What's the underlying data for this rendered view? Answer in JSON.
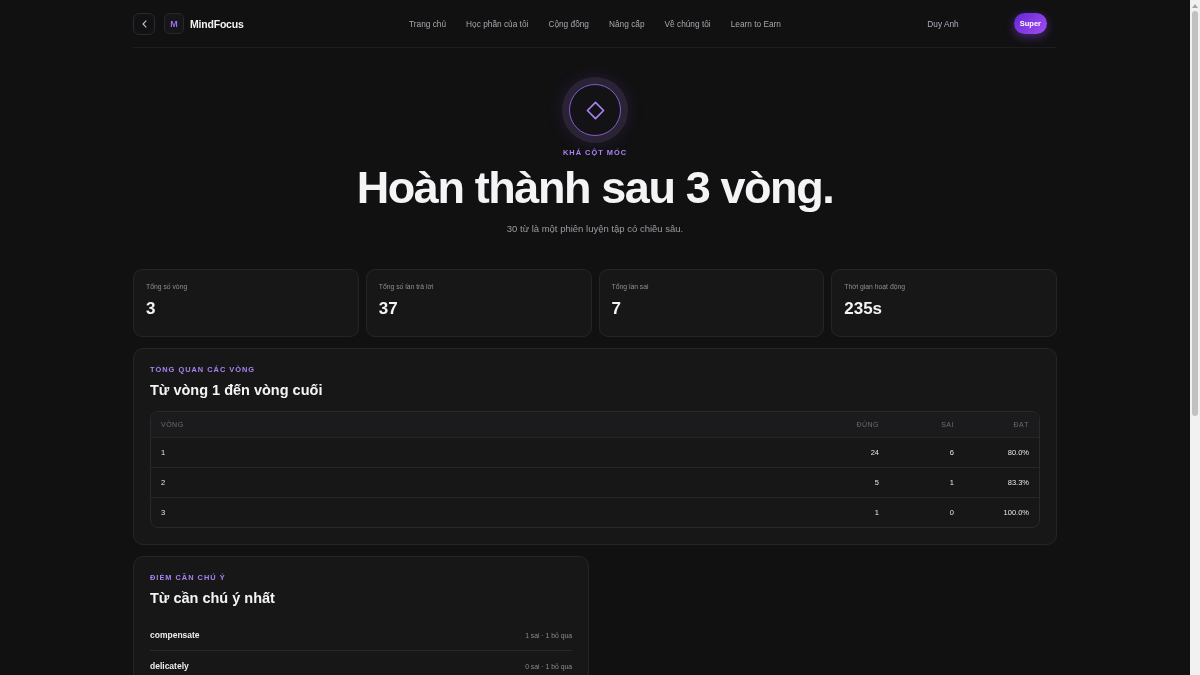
{
  "header": {
    "logo_letter": "M",
    "brand": "MindFocus",
    "nav": [
      {
        "label": "Trang chủ"
      },
      {
        "label": "Học phần của tôi"
      },
      {
        "label": "Cộng đồng"
      },
      {
        "label": "Nâng cấp"
      },
      {
        "label": "Về chúng tôi"
      },
      {
        "label": "Learn to Earn"
      }
    ],
    "user_name": "Duy Anh",
    "plan_badge": "Super"
  },
  "hero": {
    "eyebrow": "KHÁ CỘT MỐC",
    "title": "Hoàn thành sau 3 vòng.",
    "subtitle": "30 từ là một phiên luyện tập có chiều sâu."
  },
  "stats": [
    {
      "label": "Tổng số vòng",
      "value": "3"
    },
    {
      "label": "Tổng số lần trả lời",
      "value": "37"
    },
    {
      "label": "Tổng lần sai",
      "value": "7"
    },
    {
      "label": "Thời gian hoạt động",
      "value": "235s"
    }
  ],
  "rounds_overview": {
    "eyebrow": "TỔNG QUAN CÁC VÒNG",
    "title": "Từ vòng 1 đến vòng cuối",
    "columns": [
      "VÒNG",
      "ĐÚNG",
      "SAI",
      "ĐẠT"
    ],
    "rows": [
      [
        "1",
        "24",
        "6",
        "80.0%"
      ],
      [
        "2",
        "5",
        "1",
        "83.3%"
      ],
      [
        "3",
        "1",
        "0",
        "100.0%"
      ]
    ]
  },
  "attention": {
    "eyebrow": "ĐIỂM CẦN CHÚ Ý",
    "title": "Từ cần chú ý nhất",
    "words": [
      {
        "word": "compensate",
        "stats": "1 sai · 1 bỏ qua"
      },
      {
        "word": "delicately",
        "stats": "0 sai · 1 bỏ qua"
      }
    ]
  }
}
